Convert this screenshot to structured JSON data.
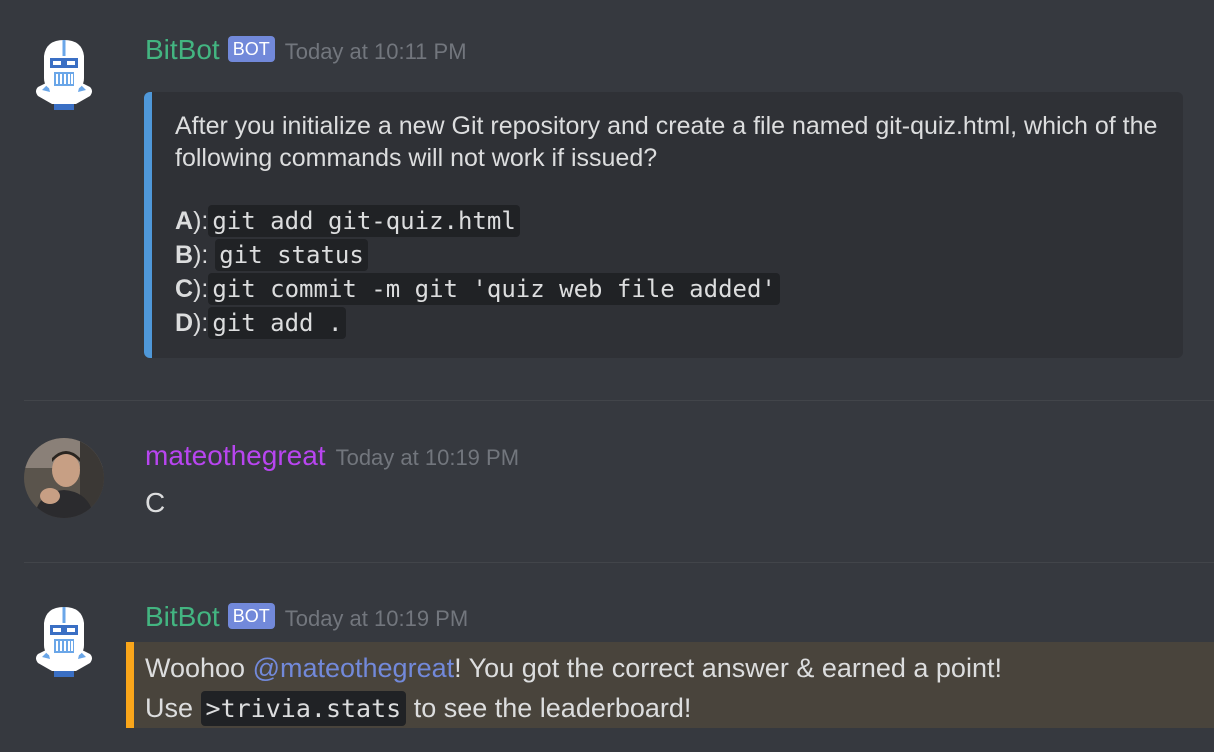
{
  "colors": {
    "bot_name": "#43b581",
    "user_name": "#b845f0",
    "mention": "#7289da",
    "embed_border": "#4f98d9",
    "highlight_border": "#faa61a",
    "background": "#36393f"
  },
  "messages": [
    {
      "author": "BitBot",
      "bot_tag": "BOT",
      "timestamp": "Today at 10:11 PM",
      "avatar_icon": "robot-knight-icon",
      "embed": {
        "question": "After you initialize a new Git repository and create a file named git-quiz.html, which of the following commands will not work if issued?",
        "options": [
          {
            "letter": "A",
            "suffix": "):",
            "code": "git add git-quiz.html"
          },
          {
            "letter": "B",
            "suffix": "):",
            "code": "git status"
          },
          {
            "letter": "C",
            "suffix": "):",
            "code": "git commit -m git 'quiz web file added'"
          },
          {
            "letter": "D",
            "suffix": "):",
            "code": "git add ."
          }
        ]
      }
    },
    {
      "author": "mateothegreat",
      "timestamp": "Today at 10:19 PM",
      "avatar_icon": "user-photo-avatar",
      "text": "C"
    },
    {
      "author": "BitBot",
      "bot_tag": "BOT",
      "timestamp": "Today at 10:19 PM",
      "avatar_icon": "robot-knight-icon",
      "line1_prefix": "Woohoo ",
      "mention": "@mateothegreat",
      "line1_suffix": "! You got the correct answer & earned a point!",
      "line2_prefix": "Use ",
      "line2_code": ">trivia.stats",
      "line2_suffix": " to see the leaderboard!"
    }
  ]
}
